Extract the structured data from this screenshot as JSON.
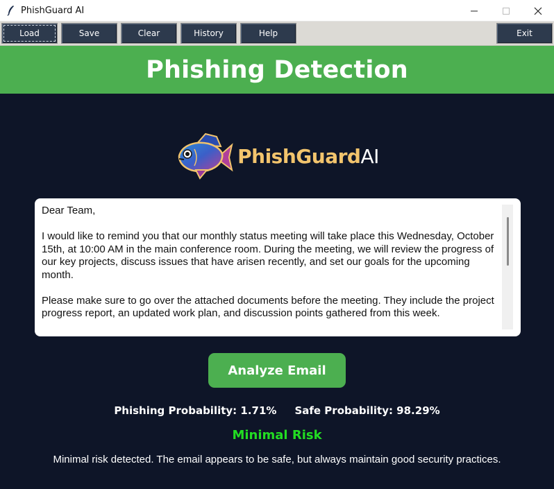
{
  "window": {
    "title": "PhishGuard AI",
    "icons": {
      "app": "feather-icon",
      "minimize": "minimize-icon",
      "maximize": "maximize-icon",
      "close": "close-icon"
    }
  },
  "menu": {
    "load": "Load",
    "save": "Save",
    "clear": "Clear",
    "history": "History",
    "help": "Help",
    "exit": "Exit"
  },
  "header": {
    "title": "Phishing Detection"
  },
  "logo": {
    "brand_main": "PhishGuard",
    "brand_suffix": "AI",
    "icon": "fish-icon"
  },
  "email": {
    "body": "Dear Team,\n\nI would like to remind you that our monthly status meeting will take place this Wednesday, October 15th, at 10:00 AM in the main conference room. During the meeting, we will review the progress of our key projects, discuss issues that have arisen recently, and set our goals for the upcoming month.\n\nPlease make sure to go over the attached documents before the meeting. They include the project progress report, an updated work plan, and discussion points gathered from this week."
  },
  "analyze_button": {
    "label": "Analyze Email"
  },
  "results": {
    "phishing_probability": "Phishing Probability: 1.71%",
    "safe_probability": "Safe Probability: 98.29%",
    "risk_level": "Minimal Risk",
    "risk_description": "Minimal risk detected. The email appears to be safe, but always maintain good security practices."
  },
  "colors": {
    "header_green": "#4caf50",
    "background": "#0e1528",
    "menu_button": "#2d3a4d",
    "risk_green": "#22dd22",
    "logo_gold": "#f2c46d"
  }
}
